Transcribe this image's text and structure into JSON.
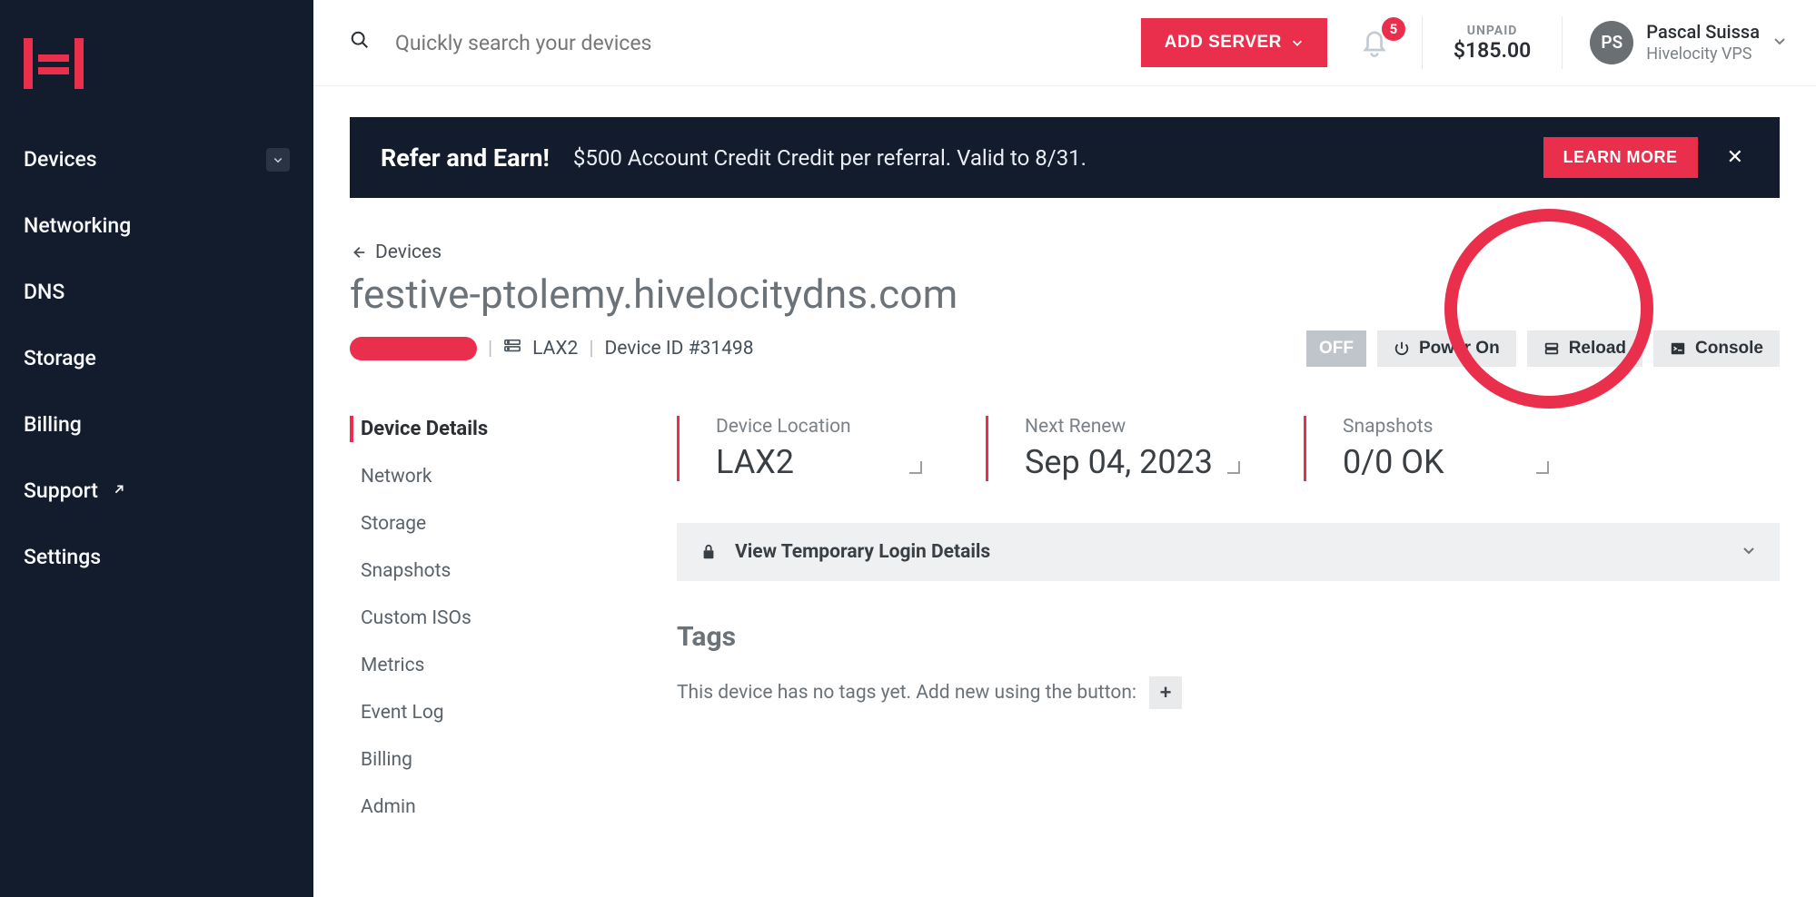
{
  "sidebar": {
    "items": [
      {
        "label": "Devices",
        "has_chevron": true
      },
      {
        "label": "Networking"
      },
      {
        "label": "DNS"
      },
      {
        "label": "Storage"
      },
      {
        "label": "Billing"
      },
      {
        "label": "Support",
        "external": true
      },
      {
        "label": "Settings"
      }
    ]
  },
  "topbar": {
    "search_placeholder": "Quickly search your devices",
    "add_server": "ADD SERVER",
    "notifications_count": "5",
    "unpaid_label": "UNPAID",
    "unpaid_amount": "$185.00",
    "user_initials": "PS",
    "user_name": "Pascal Suissa",
    "user_org": "Hivelocity VPS"
  },
  "banner": {
    "title": "Refer and Earn!",
    "desc": "$500 Account Credit Credit per referral. Valid to 8/31.",
    "cta": "LEARN MORE"
  },
  "breadcrumb": {
    "back_label": "Devices"
  },
  "device": {
    "title": "festive-ptolemy.hivelocitydns.com",
    "location_code": "LAX2",
    "device_id_label": "Device ID #31498",
    "actions": {
      "off": "OFF",
      "power_on": "Power On",
      "reload": "Reload",
      "console": "Console"
    }
  },
  "subnav": {
    "items": [
      "Device Details",
      "Network",
      "Storage",
      "Snapshots",
      "Custom ISOs",
      "Metrics",
      "Event Log",
      "Billing",
      "Admin"
    ],
    "active_index": 0
  },
  "stats": {
    "location": {
      "label": "Device Location",
      "value": "LAX2"
    },
    "renew": {
      "label": "Next Renew",
      "value": "Sep 04, 2023"
    },
    "snapshots": {
      "label": "Snapshots",
      "value": "0/0 OK"
    }
  },
  "accordion": {
    "title": "View Temporary Login Details"
  },
  "tags": {
    "heading": "Tags",
    "empty_text": "This device has no tags yet. Add new using the button:",
    "add": "+"
  },
  "colors": {
    "brand_red": "#ea2f4c",
    "sidebar_bg": "#131c2c"
  }
}
